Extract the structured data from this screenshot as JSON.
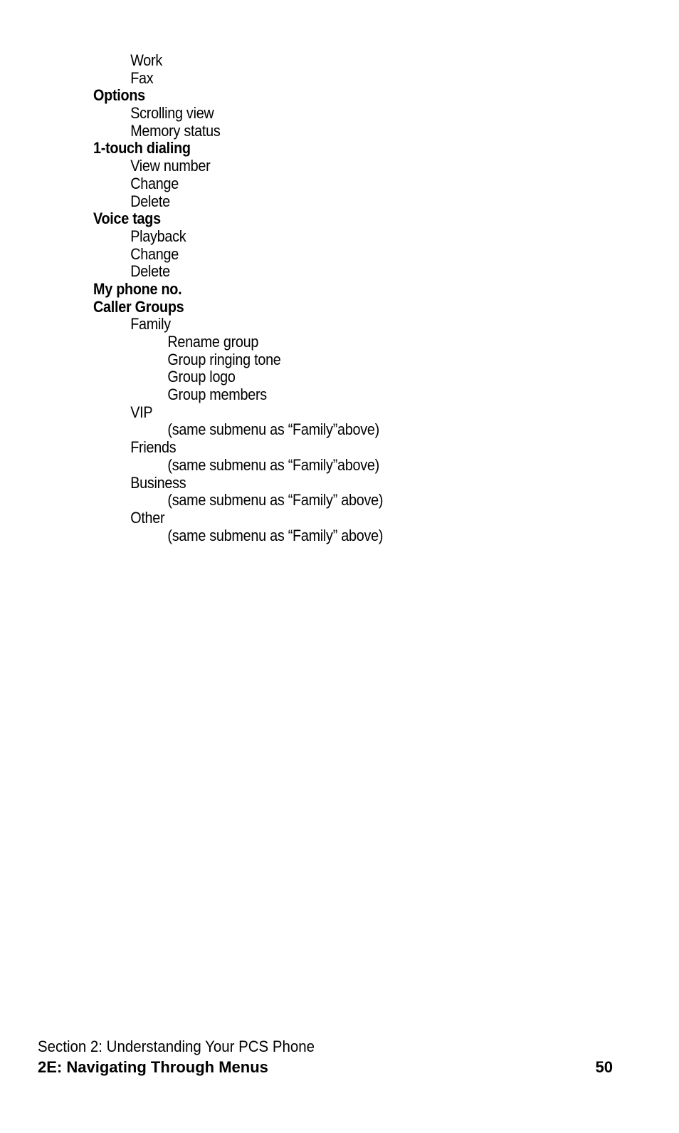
{
  "menu_items": [
    {
      "label": "Work",
      "level": 1
    },
    {
      "label": "Fax",
      "level": 1
    },
    {
      "label": "Options",
      "level": 0
    },
    {
      "label": "Scrolling view",
      "level": 1
    },
    {
      "label": "Memory status",
      "level": 1
    },
    {
      "label": "1-touch dialing",
      "level": 0
    },
    {
      "label": "View number",
      "level": 1
    },
    {
      "label": "Change",
      "level": 1
    },
    {
      "label": "Delete",
      "level": 1
    },
    {
      "label": "Voice tags",
      "level": 0
    },
    {
      "label": "Playback",
      "level": 1
    },
    {
      "label": "Change",
      "level": 1
    },
    {
      "label": "Delete",
      "level": 1
    },
    {
      "label": "My phone no.",
      "level": 0
    },
    {
      "label": "Caller Groups",
      "level": 0
    },
    {
      "label": "Family",
      "level": 1
    },
    {
      "label": "Rename group",
      "level": 2
    },
    {
      "label": "Group ringing tone",
      "level": 2
    },
    {
      "label": "Group logo",
      "level": 2
    },
    {
      "label": "Group members",
      "level": 2
    },
    {
      "label": "VIP",
      "level": 1
    },
    {
      "label": "(same submenu as “Family”above)",
      "level": 2
    },
    {
      "label": "Friends",
      "level": 1
    },
    {
      "label": "(same submenu as “Family”above)",
      "level": 2
    },
    {
      "label": "Business",
      "level": 1
    },
    {
      "label": "(same submenu as “Family” above)",
      "level": 2
    },
    {
      "label": "Other",
      "level": 1
    },
    {
      "label": "(same submenu as “Family” above)",
      "level": 2
    }
  ],
  "footer": {
    "section": "Section 2: Understanding Your PCS Phone",
    "chapter": "2E: Navigating Through Menus",
    "page_number": "50"
  }
}
